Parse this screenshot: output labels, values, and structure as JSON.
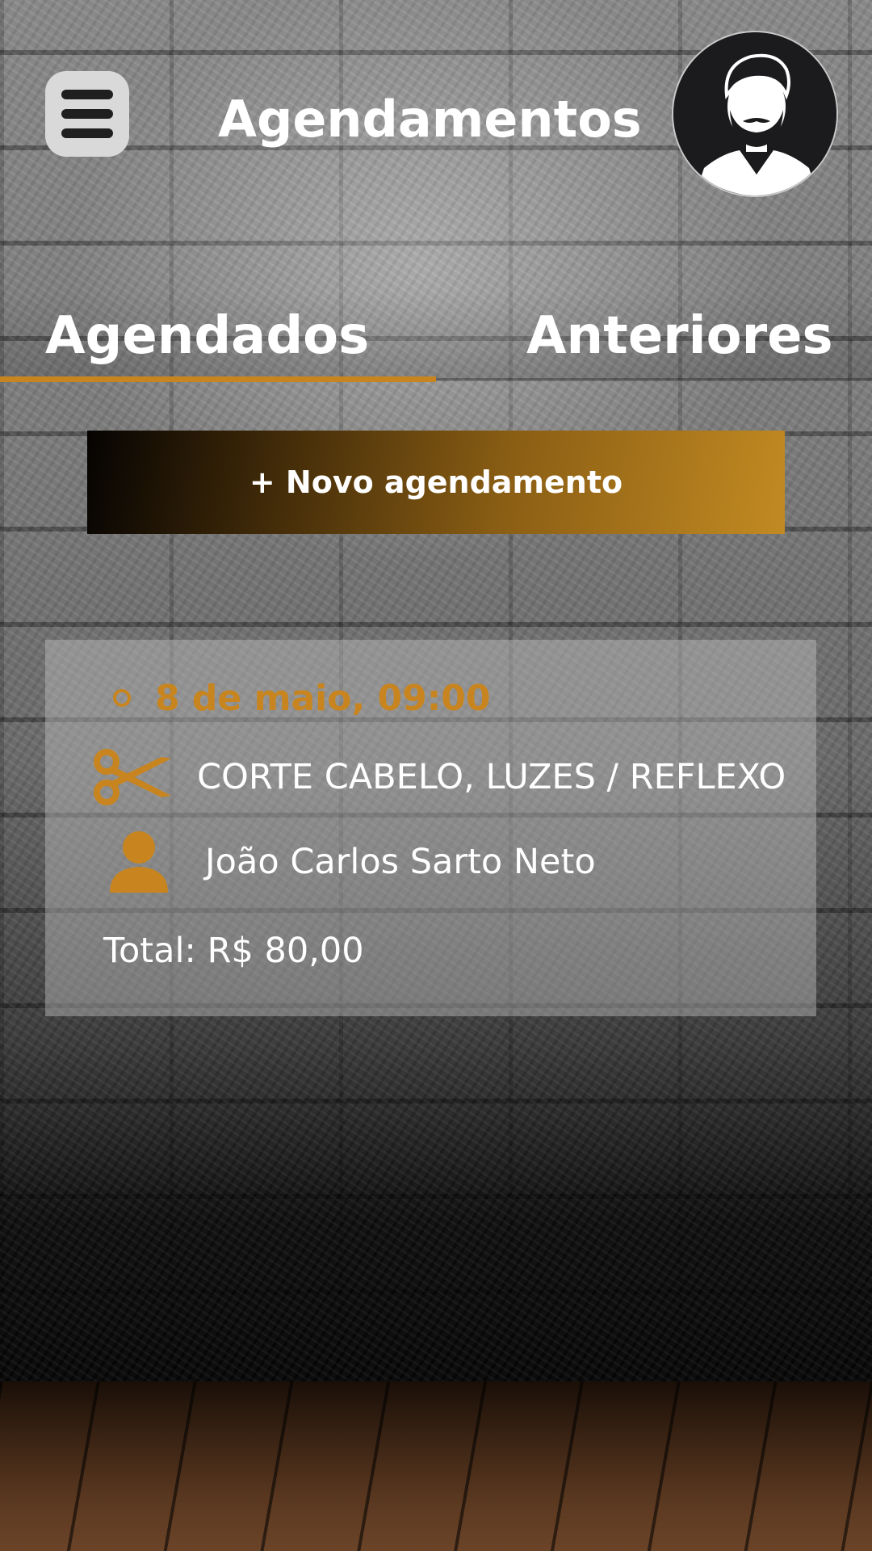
{
  "header": {
    "title": "Agendamentos",
    "menu_icon": "hamburger-menu-icon",
    "avatar_icon": "bearded-man-avatar"
  },
  "tabs": [
    {
      "label": "Agendados",
      "active": true
    },
    {
      "label": "Anteriores",
      "active": false
    }
  ],
  "new_button": {
    "label": "+ Novo agendamento"
  },
  "appointment": {
    "date": "8 de maio, 09:00",
    "service": "CORTE CABELO, LUZES / REFLEXO",
    "professional": "João Carlos Sarto Neto",
    "total": "Total: R$ 80,00",
    "service_icon": "scissors-icon",
    "person_icon": "person-icon"
  },
  "colors": {
    "accent": "#c8851f",
    "tab_text": "#ffffff",
    "button_gradient_start": "#050302",
    "button_gradient_end": "#c28a22"
  }
}
